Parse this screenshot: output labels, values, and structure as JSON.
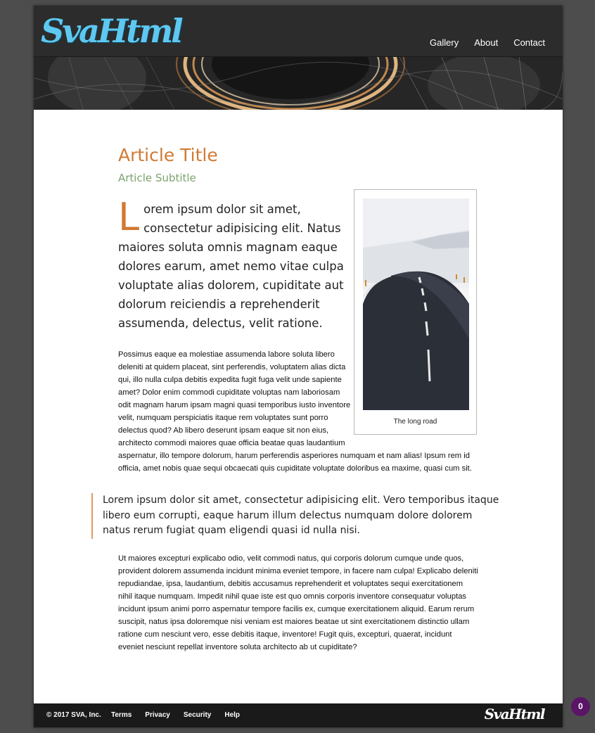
{
  "brand": {
    "logo_text": "SvaHtml",
    "logo_color": "#5fc8f0"
  },
  "nav": {
    "items": [
      "Gallery",
      "About",
      "Contact"
    ]
  },
  "article": {
    "title": "Article Title",
    "subtitle": "Article Subtitle",
    "lead_dropcap": "L",
    "lead_text": "orem ipsum dolor sit amet, consectetur adipisicing elit. Natus maiores soluta omnis magnam eaque dolores earum, amet nemo vitae culpa voluptate alias dolorem, cupiditate aut dolorum reiciendis a reprehenderit assumenda, delectus, velit ratione.",
    "paragraph_1": "Possimus eaque ea molestiae assumenda labore soluta libero deleniti at quidem placeat, sint perferendis, voluptatem alias dicta qui, illo nulla culpa debitis expedita fugit fuga velit unde sapiente amet? Dolor enim commodi cupiditate voluptas nam laboriosam odit magnam harum ipsam magni quasi temporibus iusto inventore velit, numquam perspiciatis itaque rem voluptates sunt porro delectus quod? Ab libero deserunt ipsam eaque sit non eius, architecto commodi maiores quae officia beatae quas laudantium aspernatur, illo tempore dolorum, harum perferendis asperiores numquam et nam alias! Ipsum rem id officia, amet nobis quae sequi obcaecati quis cupiditate voluptate doloribus ea maxime, quasi cum sit.",
    "pull_quote": "Lorem ipsum dolor sit amet, consectetur adipisicing elit. Vero temporibus itaque libero eum corrupti, eaque harum illum delectus numquam dolore dolorem natus rerum fugiat quam eligendi quasi id nulla nisi.",
    "paragraph_2": "Ut maiores excepturi explicabo odio, velit commodi natus, qui corporis dolorum cumque unde quos, provident dolorem assumenda incidunt minima eveniet tempore, in facere nam culpa! Explicabo deleniti repudiandae, ipsa, laudantium, debitis accusamus reprehenderit et voluptates sequi exercitationem nihil itaque numquam. Impedit nihil quae iste est quo omnis corporis inventore consequatur voluptas incidunt ipsum animi porro aspernatur tempore facilis ex, cumque exercitationem aliquid. Earum rerum suscipit, natus ipsa doloremque nisi veniam est maiores beatae ut sint exercitationem distinctio ullam ratione cum nesciunt vero, esse debitis itaque, inventore! Fugit quis, excepturi, quaerat, incidunt eveniet nesciunt repellat inventore soluta architecto ab ut cupiditate?",
    "figure_caption": "The long road"
  },
  "footer": {
    "copyright": "© 2017 SVA, Inc.",
    "links": [
      "Terms",
      "Privacy",
      "Security",
      "Help"
    ],
    "logo_text": "SvaHtml"
  },
  "badge": {
    "count": "0"
  },
  "colors": {
    "accent": "#d07a33",
    "subtitle": "#7ba46c",
    "pull_border": "#e09a5b",
    "badge": "#5a1566"
  }
}
